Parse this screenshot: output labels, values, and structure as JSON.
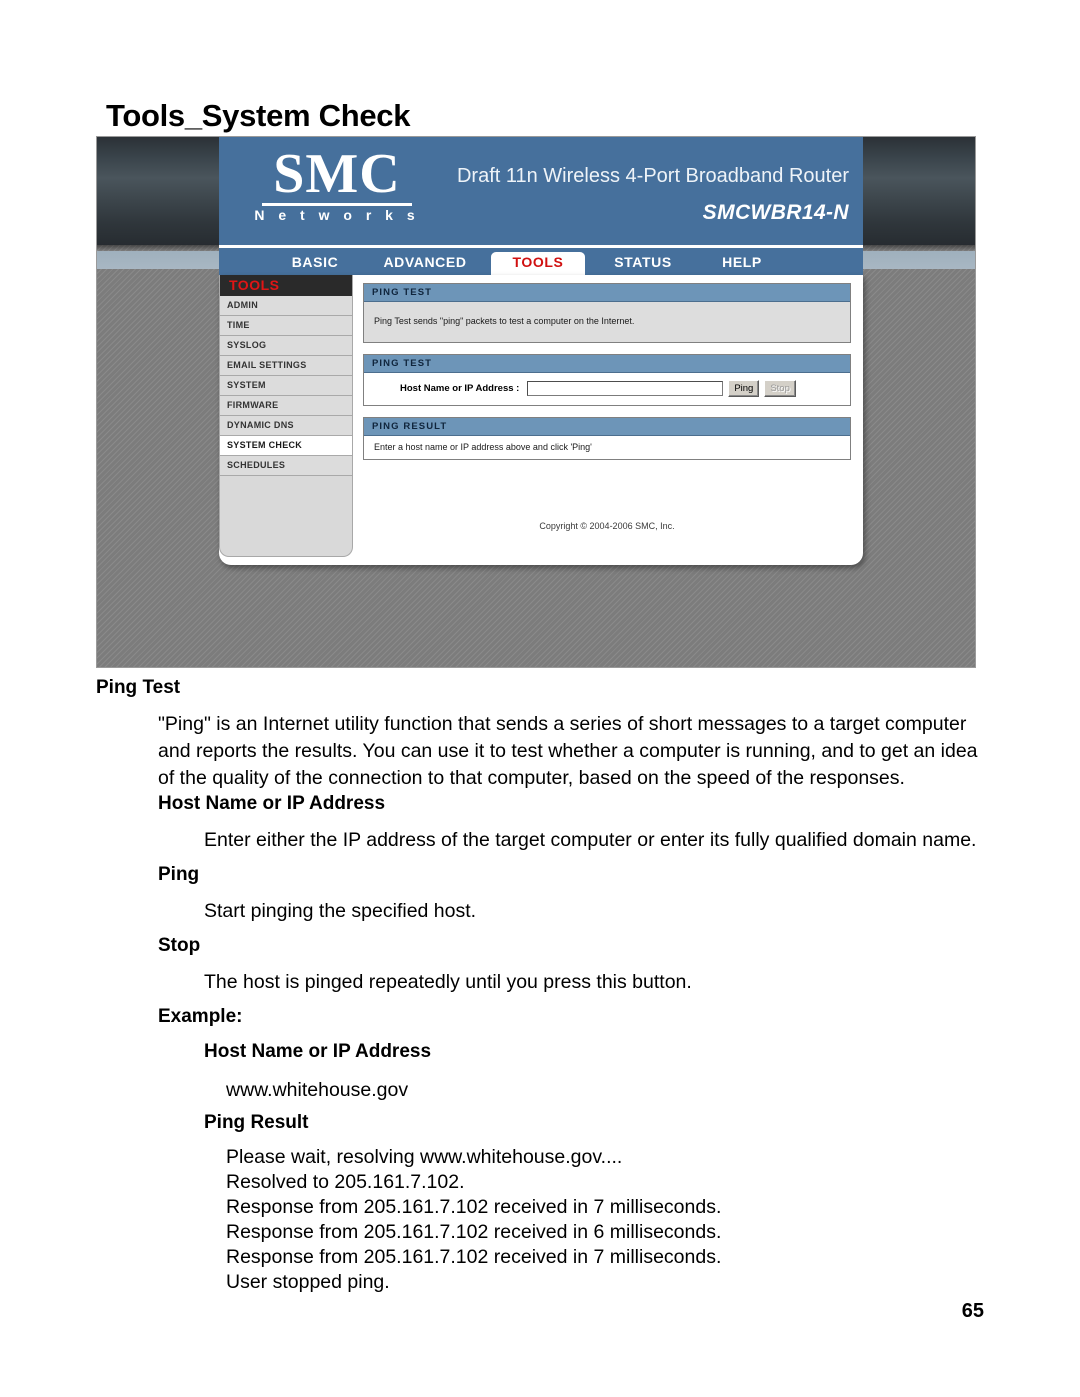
{
  "document": {
    "title": "Tools_System Check",
    "page_number": "65"
  },
  "router_ui": {
    "header": {
      "logo_primary": "SMC",
      "logo_secondary": "N e t w o r k s",
      "product_name": "Draft 11n Wireless 4-Port Broadband Router",
      "model": "SMCWBR14-N"
    },
    "nav": [
      {
        "label": "BASIC",
        "active": false
      },
      {
        "label": "ADVANCED",
        "active": false
      },
      {
        "label": "TOOLS",
        "active": true
      },
      {
        "label": "STATUS",
        "active": false
      },
      {
        "label": "HELP",
        "active": false
      }
    ],
    "sidebar": {
      "title": "TOOLS",
      "items": [
        {
          "label": "ADMIN",
          "active": false
        },
        {
          "label": "TIME",
          "active": false
        },
        {
          "label": "SYSLOG",
          "active": false
        },
        {
          "label": "EMAIL SETTINGS",
          "active": false
        },
        {
          "label": "SYSTEM",
          "active": false
        },
        {
          "label": "FIRMWARE",
          "active": false
        },
        {
          "label": "DYNAMIC DNS",
          "active": false
        },
        {
          "label": "SYSTEM CHECK",
          "active": true
        },
        {
          "label": "SCHEDULES",
          "active": false
        }
      ]
    },
    "panels": {
      "info": {
        "title": "PING TEST",
        "text": "Ping Test sends \"ping\" packets to test a computer on the Internet."
      },
      "form": {
        "title": "PING TEST",
        "field_label": "Host Name or IP Address :",
        "field_value": "",
        "field_placeholder": "",
        "ping_button": "Ping",
        "stop_button": "Stop"
      },
      "result": {
        "title": "PING RESULT",
        "text": "Enter a host name or IP address above and click 'Ping'"
      }
    },
    "copyright": "Copyright © 2004-2006 SMC, Inc."
  },
  "sections": {
    "ping_test": {
      "heading": "Ping Test",
      "body": "\"Ping\" is an Internet utility function that sends a series of short messages to a target computer and reports the results. You can use it to test whether a computer is running, and to get an idea of the quality of the connection to that computer, based on the speed of the responses."
    },
    "host_name": {
      "heading": "Host Name or IP Address",
      "body": "Enter either the IP address of the target computer or enter its fully qualified domain name."
    },
    "ping": {
      "heading": "Ping",
      "body": "Start pinging the specified host."
    },
    "stop": {
      "heading": "Stop",
      "body": "The host is pinged repeatedly until you press this button."
    },
    "example": {
      "heading": "Example:",
      "host_heading": "Host Name or IP Address",
      "host_value": "www.whitehouse.gov",
      "result_heading": "Ping Result",
      "result_lines": "Please wait, resolving www.whitehouse.gov....\nResolved to 205.161.7.102.\nResponse from 205.161.7.102 received in 7 milliseconds.\nResponse from 205.161.7.102 received in 6 milliseconds.\nResponse from 205.161.7.102 received in 7 milliseconds.\nUser stopped ping."
    }
  }
}
